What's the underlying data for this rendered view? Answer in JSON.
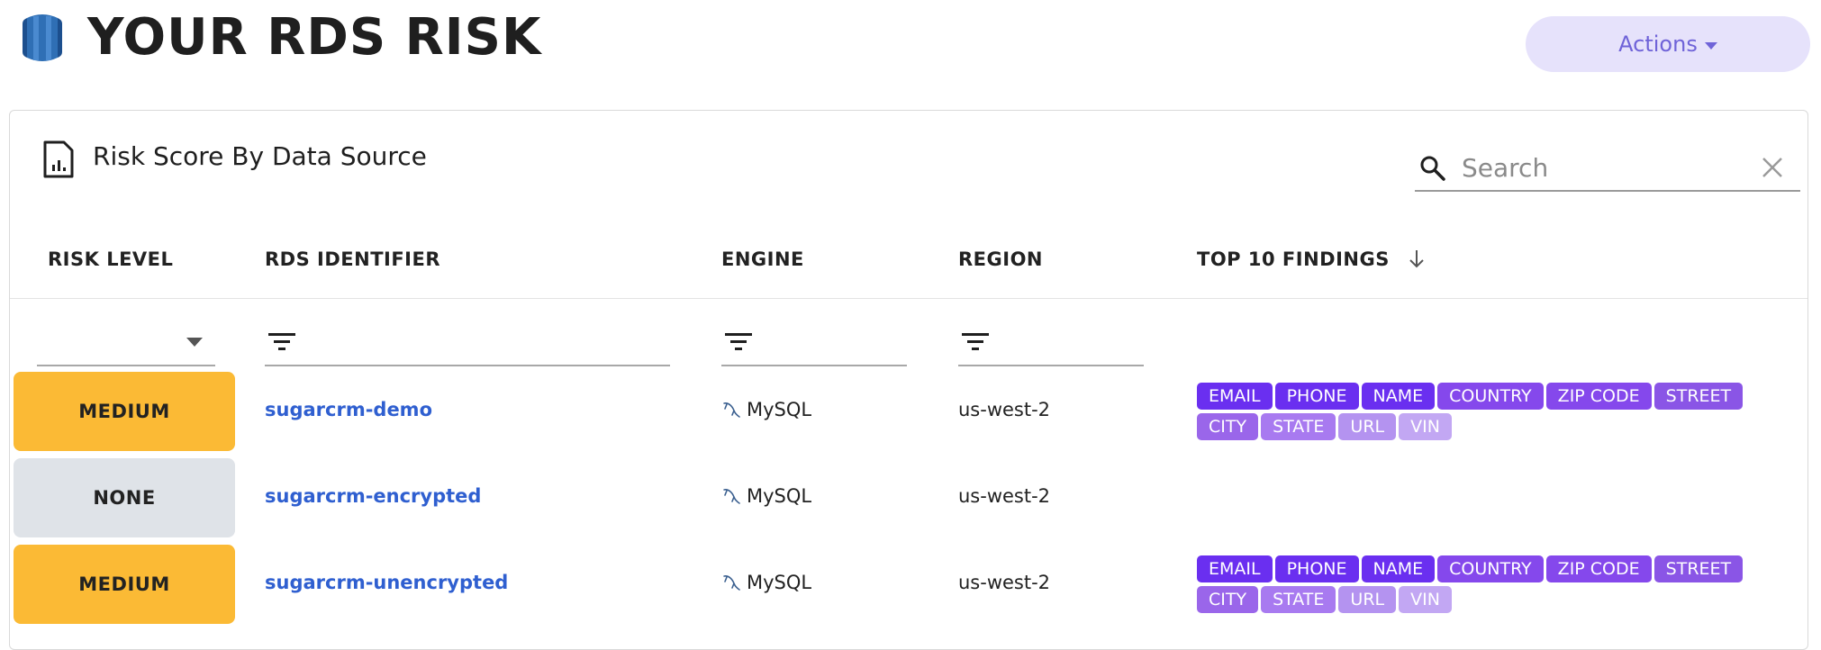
{
  "header": {
    "title": "YOUR RDS RISK",
    "actions_label": "Actions"
  },
  "card": {
    "title": "Risk Score By Data Source",
    "search_placeholder": "Search"
  },
  "columns": {
    "risk_level": "RISK LEVEL",
    "rds_identifier": "RDS IDENTIFIER",
    "engine": "ENGINE",
    "region": "REGION",
    "top_findings": "TOP 10 FINDINGS"
  },
  "rows": [
    {
      "risk": "MEDIUM",
      "risk_color": "#fbba35",
      "identifier": "sugarcrm-demo",
      "engine": "MySQL",
      "region": "us-west-2",
      "findings": [
        "EMAIL",
        "PHONE",
        "NAME",
        "COUNTRY",
        "ZIP CODE",
        "STREET",
        "CITY",
        "STATE",
        "URL",
        "VIN"
      ]
    },
    {
      "risk": "NONE",
      "risk_color": "#dfe3e8",
      "identifier": "sugarcrm-encrypted",
      "engine": "MySQL",
      "region": "us-west-2",
      "findings": []
    },
    {
      "risk": "MEDIUM",
      "risk_color": "#fbba35",
      "identifier": "sugarcrm-unencrypted",
      "engine": "MySQL",
      "region": "us-west-2",
      "findings": [
        "EMAIL",
        "PHONE",
        "NAME",
        "COUNTRY",
        "ZIP CODE",
        "STREET",
        "CITY",
        "STATE",
        "URL",
        "VIN"
      ]
    }
  ],
  "finding_tag_colors": [
    "#6a2ff0",
    "#6a2ff0",
    "#6a2ff0",
    "#8548ec",
    "#8548ec",
    "#8a55e6",
    "#9a66ea",
    "#a87af0",
    "#b493f0",
    "#c2a7f3"
  ],
  "colors": {
    "accent": "#6f63d8",
    "link": "#2f5fd0",
    "medium": "#fbba35",
    "none": "#dfe3e8"
  }
}
